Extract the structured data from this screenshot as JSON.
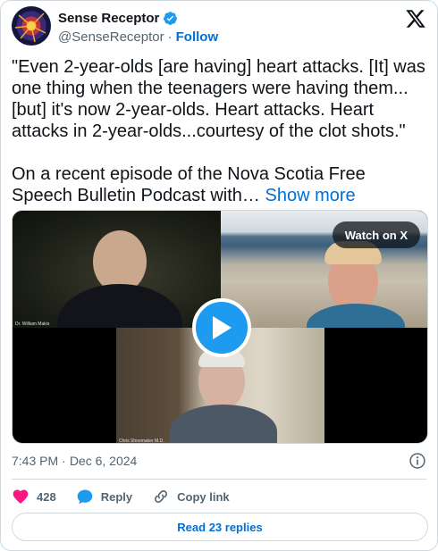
{
  "author": {
    "display_name": "Sense Receptor",
    "handle": "@SenseReceptor",
    "separator": "·",
    "follow_label": "Follow",
    "verified_color": "#1d9bf0"
  },
  "tweet": {
    "text": "\"Even 2-year-olds [are having] heart attacks. [It] was one thing when the teenagers were having them...[but] it's now 2-year-olds. Heart attacks. Heart attacks in 2-year-olds...courtesy of the clot shots.\"\n\nOn a recent episode of the Nova Scotia Free Speech Bulletin Podcast with… ",
    "show_more_label": "Show more"
  },
  "media": {
    "watch_label": "Watch on X",
    "participant_label_1": "Dr. William Makis",
    "participant_label_2": "Chris Shoemaker M.D."
  },
  "meta": {
    "time": "7:43 PM",
    "separator": "·",
    "date": "Dec 6, 2024"
  },
  "actions": {
    "like_count": "428",
    "reply_label": "Reply",
    "copy_link_label": "Copy link",
    "read_replies_label": "Read 23 replies"
  },
  "colors": {
    "accent": "#1d9bf0",
    "link": "#006fd6",
    "like": "#f91880",
    "secondary_text": "#536471"
  },
  "icons": [
    "verified-badge-icon",
    "x-logo-icon",
    "play-icon",
    "info-icon",
    "heart-icon",
    "reply-icon",
    "link-icon"
  ]
}
